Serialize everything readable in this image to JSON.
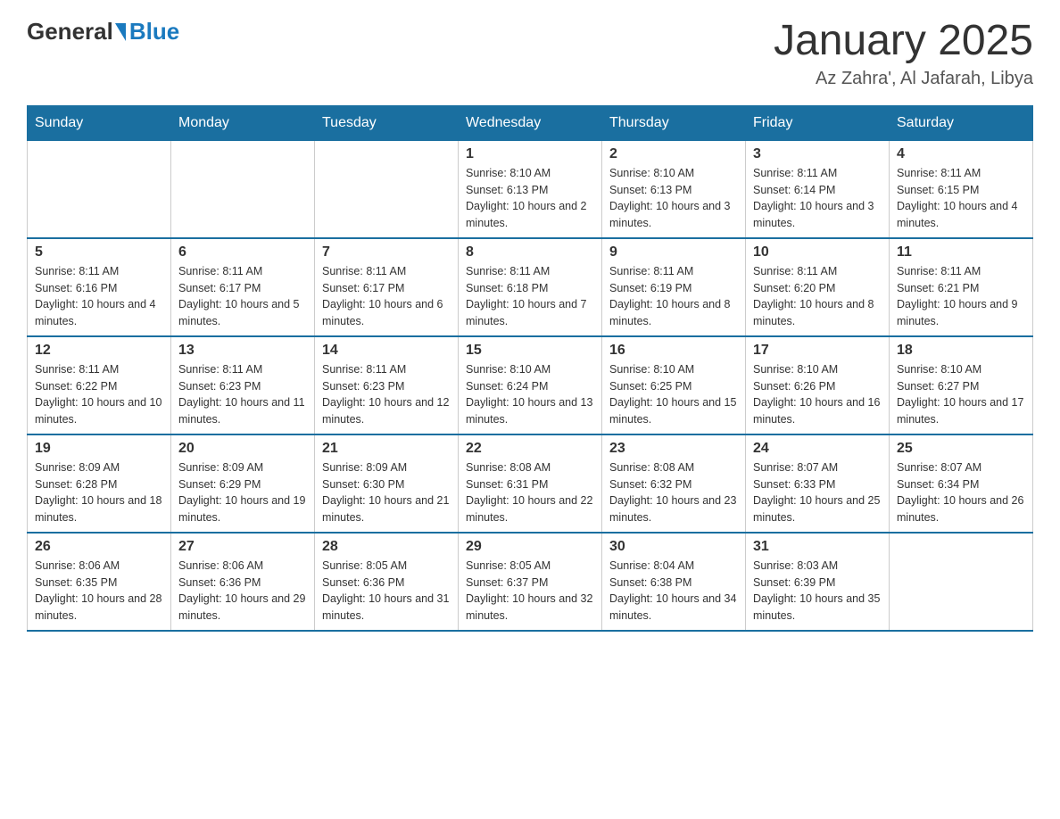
{
  "logo": {
    "general": "General",
    "blue": "Blue"
  },
  "header": {
    "month": "January 2025",
    "location": "Az Zahra', Al Jafarah, Libya"
  },
  "days_of_week": [
    "Sunday",
    "Monday",
    "Tuesday",
    "Wednesday",
    "Thursday",
    "Friday",
    "Saturday"
  ],
  "weeks": [
    [
      {
        "day": "",
        "info": ""
      },
      {
        "day": "",
        "info": ""
      },
      {
        "day": "",
        "info": ""
      },
      {
        "day": "1",
        "info": "Sunrise: 8:10 AM\nSunset: 6:13 PM\nDaylight: 10 hours and 2 minutes."
      },
      {
        "day": "2",
        "info": "Sunrise: 8:10 AM\nSunset: 6:13 PM\nDaylight: 10 hours and 3 minutes."
      },
      {
        "day": "3",
        "info": "Sunrise: 8:11 AM\nSunset: 6:14 PM\nDaylight: 10 hours and 3 minutes."
      },
      {
        "day": "4",
        "info": "Sunrise: 8:11 AM\nSunset: 6:15 PM\nDaylight: 10 hours and 4 minutes."
      }
    ],
    [
      {
        "day": "5",
        "info": "Sunrise: 8:11 AM\nSunset: 6:16 PM\nDaylight: 10 hours and 4 minutes."
      },
      {
        "day": "6",
        "info": "Sunrise: 8:11 AM\nSunset: 6:17 PM\nDaylight: 10 hours and 5 minutes."
      },
      {
        "day": "7",
        "info": "Sunrise: 8:11 AM\nSunset: 6:17 PM\nDaylight: 10 hours and 6 minutes."
      },
      {
        "day": "8",
        "info": "Sunrise: 8:11 AM\nSunset: 6:18 PM\nDaylight: 10 hours and 7 minutes."
      },
      {
        "day": "9",
        "info": "Sunrise: 8:11 AM\nSunset: 6:19 PM\nDaylight: 10 hours and 8 minutes."
      },
      {
        "day": "10",
        "info": "Sunrise: 8:11 AM\nSunset: 6:20 PM\nDaylight: 10 hours and 8 minutes."
      },
      {
        "day": "11",
        "info": "Sunrise: 8:11 AM\nSunset: 6:21 PM\nDaylight: 10 hours and 9 minutes."
      }
    ],
    [
      {
        "day": "12",
        "info": "Sunrise: 8:11 AM\nSunset: 6:22 PM\nDaylight: 10 hours and 10 minutes."
      },
      {
        "day": "13",
        "info": "Sunrise: 8:11 AM\nSunset: 6:23 PM\nDaylight: 10 hours and 11 minutes."
      },
      {
        "day": "14",
        "info": "Sunrise: 8:11 AM\nSunset: 6:23 PM\nDaylight: 10 hours and 12 minutes."
      },
      {
        "day": "15",
        "info": "Sunrise: 8:10 AM\nSunset: 6:24 PM\nDaylight: 10 hours and 13 minutes."
      },
      {
        "day": "16",
        "info": "Sunrise: 8:10 AM\nSunset: 6:25 PM\nDaylight: 10 hours and 15 minutes."
      },
      {
        "day": "17",
        "info": "Sunrise: 8:10 AM\nSunset: 6:26 PM\nDaylight: 10 hours and 16 minutes."
      },
      {
        "day": "18",
        "info": "Sunrise: 8:10 AM\nSunset: 6:27 PM\nDaylight: 10 hours and 17 minutes."
      }
    ],
    [
      {
        "day": "19",
        "info": "Sunrise: 8:09 AM\nSunset: 6:28 PM\nDaylight: 10 hours and 18 minutes."
      },
      {
        "day": "20",
        "info": "Sunrise: 8:09 AM\nSunset: 6:29 PM\nDaylight: 10 hours and 19 minutes."
      },
      {
        "day": "21",
        "info": "Sunrise: 8:09 AM\nSunset: 6:30 PM\nDaylight: 10 hours and 21 minutes."
      },
      {
        "day": "22",
        "info": "Sunrise: 8:08 AM\nSunset: 6:31 PM\nDaylight: 10 hours and 22 minutes."
      },
      {
        "day": "23",
        "info": "Sunrise: 8:08 AM\nSunset: 6:32 PM\nDaylight: 10 hours and 23 minutes."
      },
      {
        "day": "24",
        "info": "Sunrise: 8:07 AM\nSunset: 6:33 PM\nDaylight: 10 hours and 25 minutes."
      },
      {
        "day": "25",
        "info": "Sunrise: 8:07 AM\nSunset: 6:34 PM\nDaylight: 10 hours and 26 minutes."
      }
    ],
    [
      {
        "day": "26",
        "info": "Sunrise: 8:06 AM\nSunset: 6:35 PM\nDaylight: 10 hours and 28 minutes."
      },
      {
        "day": "27",
        "info": "Sunrise: 8:06 AM\nSunset: 6:36 PM\nDaylight: 10 hours and 29 minutes."
      },
      {
        "day": "28",
        "info": "Sunrise: 8:05 AM\nSunset: 6:36 PM\nDaylight: 10 hours and 31 minutes."
      },
      {
        "day": "29",
        "info": "Sunrise: 8:05 AM\nSunset: 6:37 PM\nDaylight: 10 hours and 32 minutes."
      },
      {
        "day": "30",
        "info": "Sunrise: 8:04 AM\nSunset: 6:38 PM\nDaylight: 10 hours and 34 minutes."
      },
      {
        "day": "31",
        "info": "Sunrise: 8:03 AM\nSunset: 6:39 PM\nDaylight: 10 hours and 35 minutes."
      },
      {
        "day": "",
        "info": ""
      }
    ]
  ]
}
